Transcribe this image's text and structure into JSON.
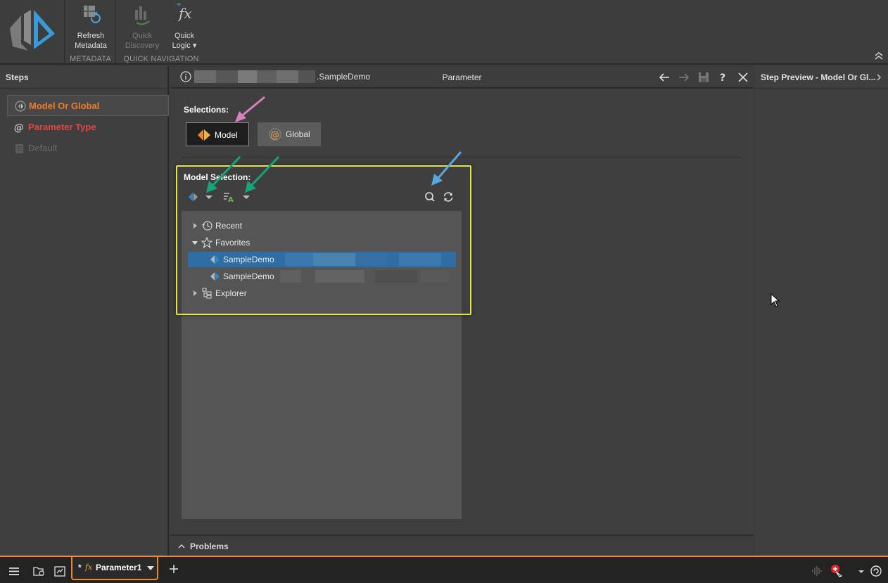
{
  "ribbon": {
    "metadata_group": {
      "label": "METADATA",
      "refresh_line1": "Refresh",
      "refresh_line2": "Metadata"
    },
    "quick_nav_group": {
      "label": "QUICK NAVIGATION",
      "discovery_line1": "Quick",
      "discovery_line2": "Discovery",
      "logic_line1": "Quick",
      "logic_line2": "Logic ▾"
    }
  },
  "steps": {
    "title": "Steps",
    "items": [
      {
        "label": "Model Or Global",
        "state": "active"
      },
      {
        "label": "Parameter Type",
        "state": "error"
      },
      {
        "label": "Default",
        "state": "disabled"
      }
    ]
  },
  "editor": {
    "path": ".SampleDemo",
    "title": "Parameter",
    "selections_label": "Selections:",
    "model_button": "Model",
    "global_button": "Global",
    "model_selection_label": "Model Selection:",
    "tree": {
      "recent": "Recent",
      "favorites": "Favorites",
      "item1": "SampleDemo",
      "item2": "SampleDemo",
      "explorer": "Explorer"
    },
    "problems_label": "Problems"
  },
  "preview": {
    "title": "Step Preview - Model Or Gl..."
  },
  "taskbar": {
    "tab_modified": "*",
    "tab_fx": "fx",
    "tab_label": "Parameter1"
  },
  "colors": {
    "accent": "#e98a33",
    "error": "#e04646",
    "selection": "#2f6ea4",
    "highlight": "#e6e24a"
  }
}
